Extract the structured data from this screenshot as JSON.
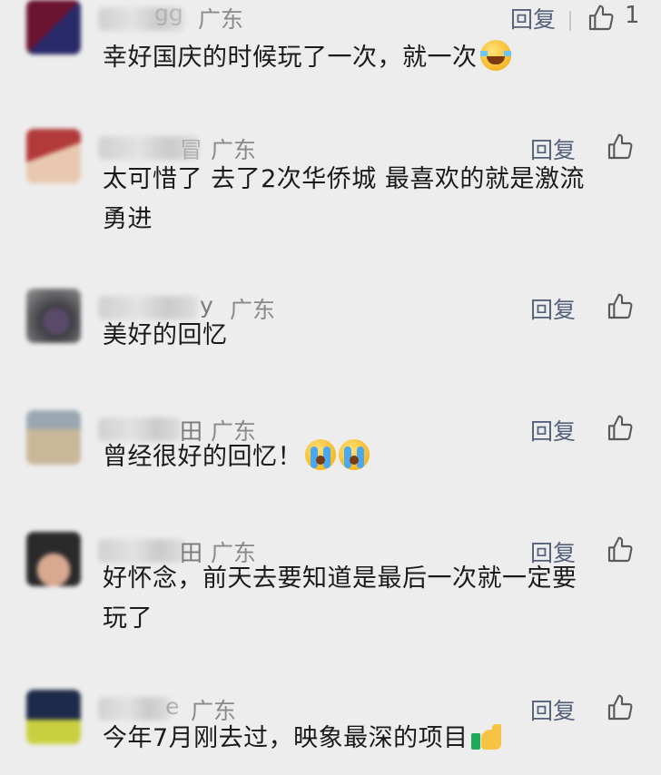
{
  "comments": [
    {
      "nick_fragment": "gg",
      "region": "广东",
      "reply_label": "回复",
      "like_count": "1",
      "text": "幸好国庆的时候玩了一次，就一次",
      "emoji": "laughing-tears-icon",
      "avatar_colors": [
        "#6b1330",
        "#2a2a6a"
      ]
    },
    {
      "nick_fragment": "冒",
      "region": "广东",
      "reply_label": "回复",
      "like_count": "",
      "text_line1": "太可惜了  去了2次华侨城 最喜欢的就是激流",
      "text_line2": "勇进",
      "avatar_colors": [
        "#b23a3a",
        "#e8c8b0"
      ]
    },
    {
      "nick_fragment": "y",
      "region": "广东",
      "reply_label": "回复",
      "like_count": "",
      "text": "美好的回忆",
      "avatar_colors": [
        "#3a3a40",
        "#8a8a8a"
      ]
    },
    {
      "nick_fragment": "田",
      "region": "广东",
      "reply_label": "回复",
      "like_count": "",
      "text": "曾经很好的回忆！",
      "emoji": "crying-icon",
      "avatar_colors": [
        "#c9b79a",
        "#9aa7b0"
      ]
    },
    {
      "nick_fragment": "田",
      "region": "广东",
      "reply_label": "回复",
      "like_count": "",
      "text_line1": "好怀念，前天去要知道是最后一次就一定要",
      "text_line2": "玩了",
      "avatar_colors": [
        "#2a2a2a",
        "#d8a890"
      ]
    },
    {
      "nick_fragment": "e",
      "region": "广东",
      "reply_label": "回复",
      "like_count": "",
      "text": "今年7月刚去过，映象最深的项目",
      "emoji": "thumbs-up-emoji",
      "avatar_colors": [
        "#1e2a4a",
        "#c8d040"
      ]
    }
  ],
  "colors": {
    "background": "#ededed",
    "reply": "#55607a",
    "region": "#8a8a8a"
  }
}
